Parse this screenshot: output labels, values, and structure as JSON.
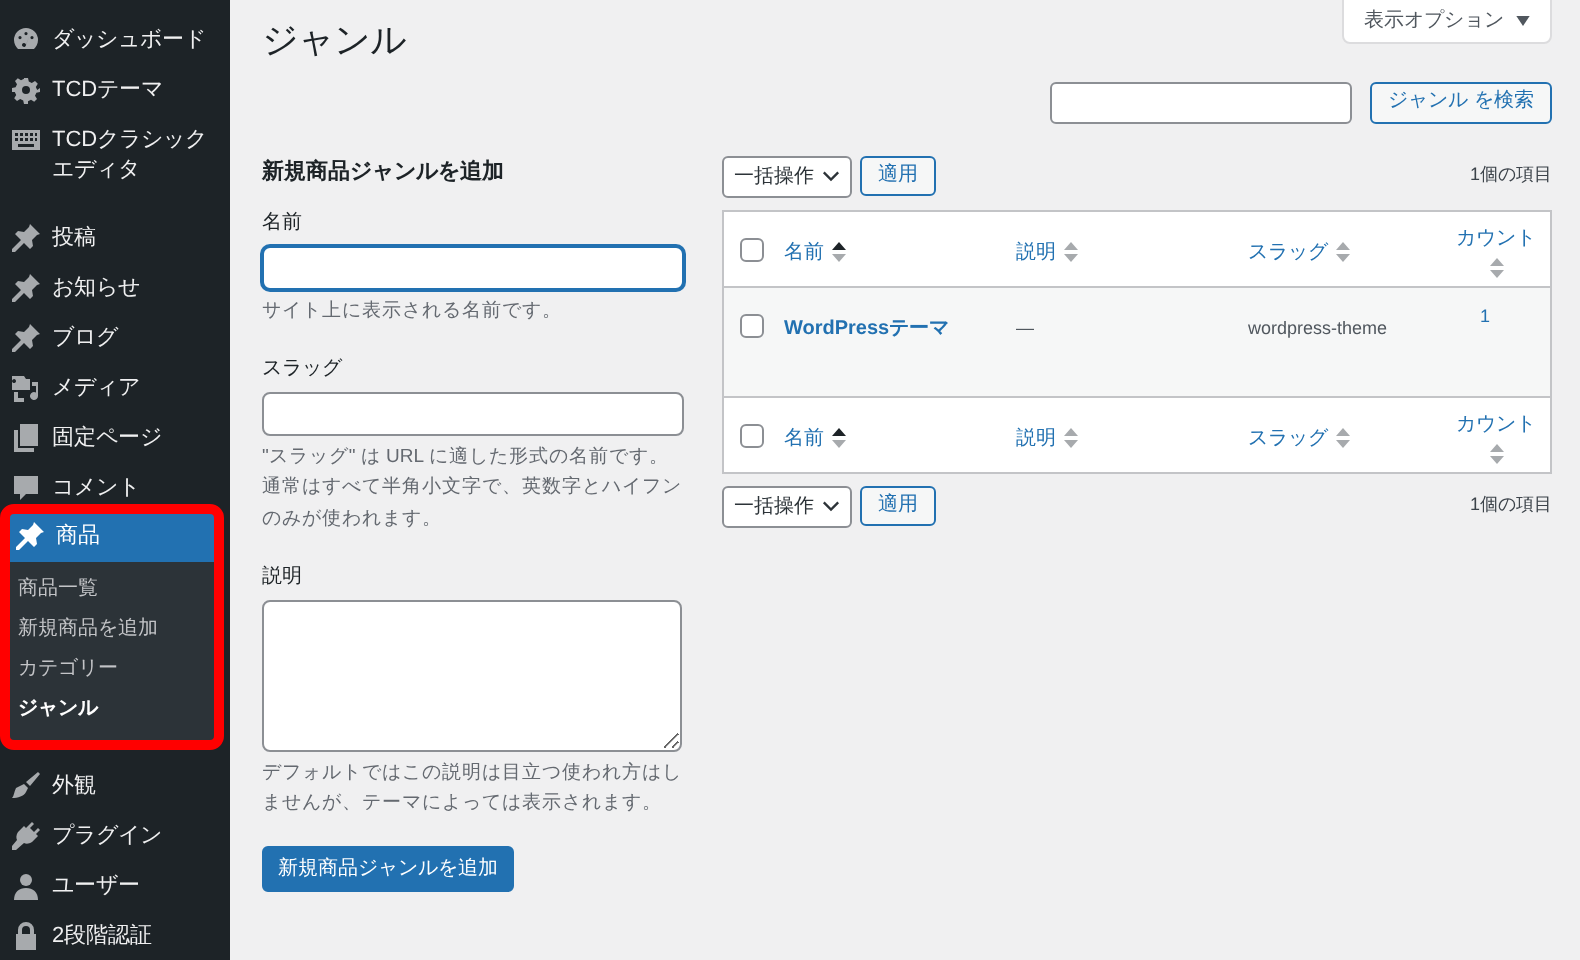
{
  "sidebar": {
    "items": [
      {
        "label": "ダッシュボード",
        "selected": false
      },
      {
        "label": "TCDテーマ",
        "selected": false
      },
      {
        "label": "TCDクラシックエディタ",
        "selected": false
      },
      {
        "label": "投稿",
        "selected": false
      },
      {
        "label": "お知らせ",
        "selected": false
      },
      {
        "label": "ブログ",
        "selected": false
      },
      {
        "label": "メディア",
        "selected": false
      },
      {
        "label": "固定ページ",
        "selected": false
      },
      {
        "label": "コメント",
        "selected": false
      },
      {
        "label": "商品",
        "selected": true,
        "highlighted": true,
        "submenu": [
          {
            "label": "商品一覧",
            "selected": false
          },
          {
            "label": "新規商品を追加",
            "selected": false
          },
          {
            "label": "カテゴリー",
            "selected": false
          },
          {
            "label": "ジャンル",
            "selected": true
          }
        ]
      },
      {
        "label": "外観",
        "selected": false
      },
      {
        "label": "プラグイン",
        "selected": false
      },
      {
        "label": "ユーザー",
        "selected": false
      },
      {
        "label": "2段階認証",
        "selected": false
      }
    ]
  },
  "page_title": "ジャンル",
  "screen_options": "表示オプション",
  "search": {
    "button": "ジャンル を検索"
  },
  "form": {
    "heading": "新規商品ジャンルを追加",
    "fields": [
      {
        "kind": "input",
        "label": "名前",
        "focused": true,
        "help": "サイト上に表示される名前です。"
      },
      {
        "kind": "input",
        "label": "スラッグ",
        "focused": false,
        "help": "\"スラッグ\" は URL に適した形式の名前です。通常はすべて半角小文字で、英数字とハイフンのみが使われます。"
      },
      {
        "kind": "textarea",
        "label": "説明",
        "focused": false,
        "help": "デフォルトではこの説明は目立つ使われ方はしませんが、テーマによっては表示されます。"
      }
    ],
    "submit": "新規商品ジャンルを追加"
  },
  "table": {
    "top_nav": {
      "bulk_action": "一括操作",
      "apply": "適用",
      "count": "1個の項目"
    },
    "header_checked": false,
    "footer_checked": false,
    "columns": [
      {
        "label": "名前",
        "sorted": true
      },
      {
        "label": "説明",
        "sorted": false
      },
      {
        "label": "スラッグ",
        "sorted": false
      },
      {
        "label": "カウント",
        "sorted": false
      }
    ],
    "rows": [
      {
        "checked": false,
        "name": "WordPressテーマ",
        "description": "—",
        "slug": "wordpress-theme",
        "count": "1"
      }
    ],
    "footer_columns": [
      {
        "label": "名前",
        "sorted": true
      },
      {
        "label": "説明",
        "sorted": false
      },
      {
        "label": "スラッグ",
        "sorted": false
      },
      {
        "label": "カウント",
        "sorted": false
      }
    ],
    "bottom_nav": {
      "bulk_action": "一括操作",
      "apply": "適用",
      "count": "1個の項目"
    }
  }
}
